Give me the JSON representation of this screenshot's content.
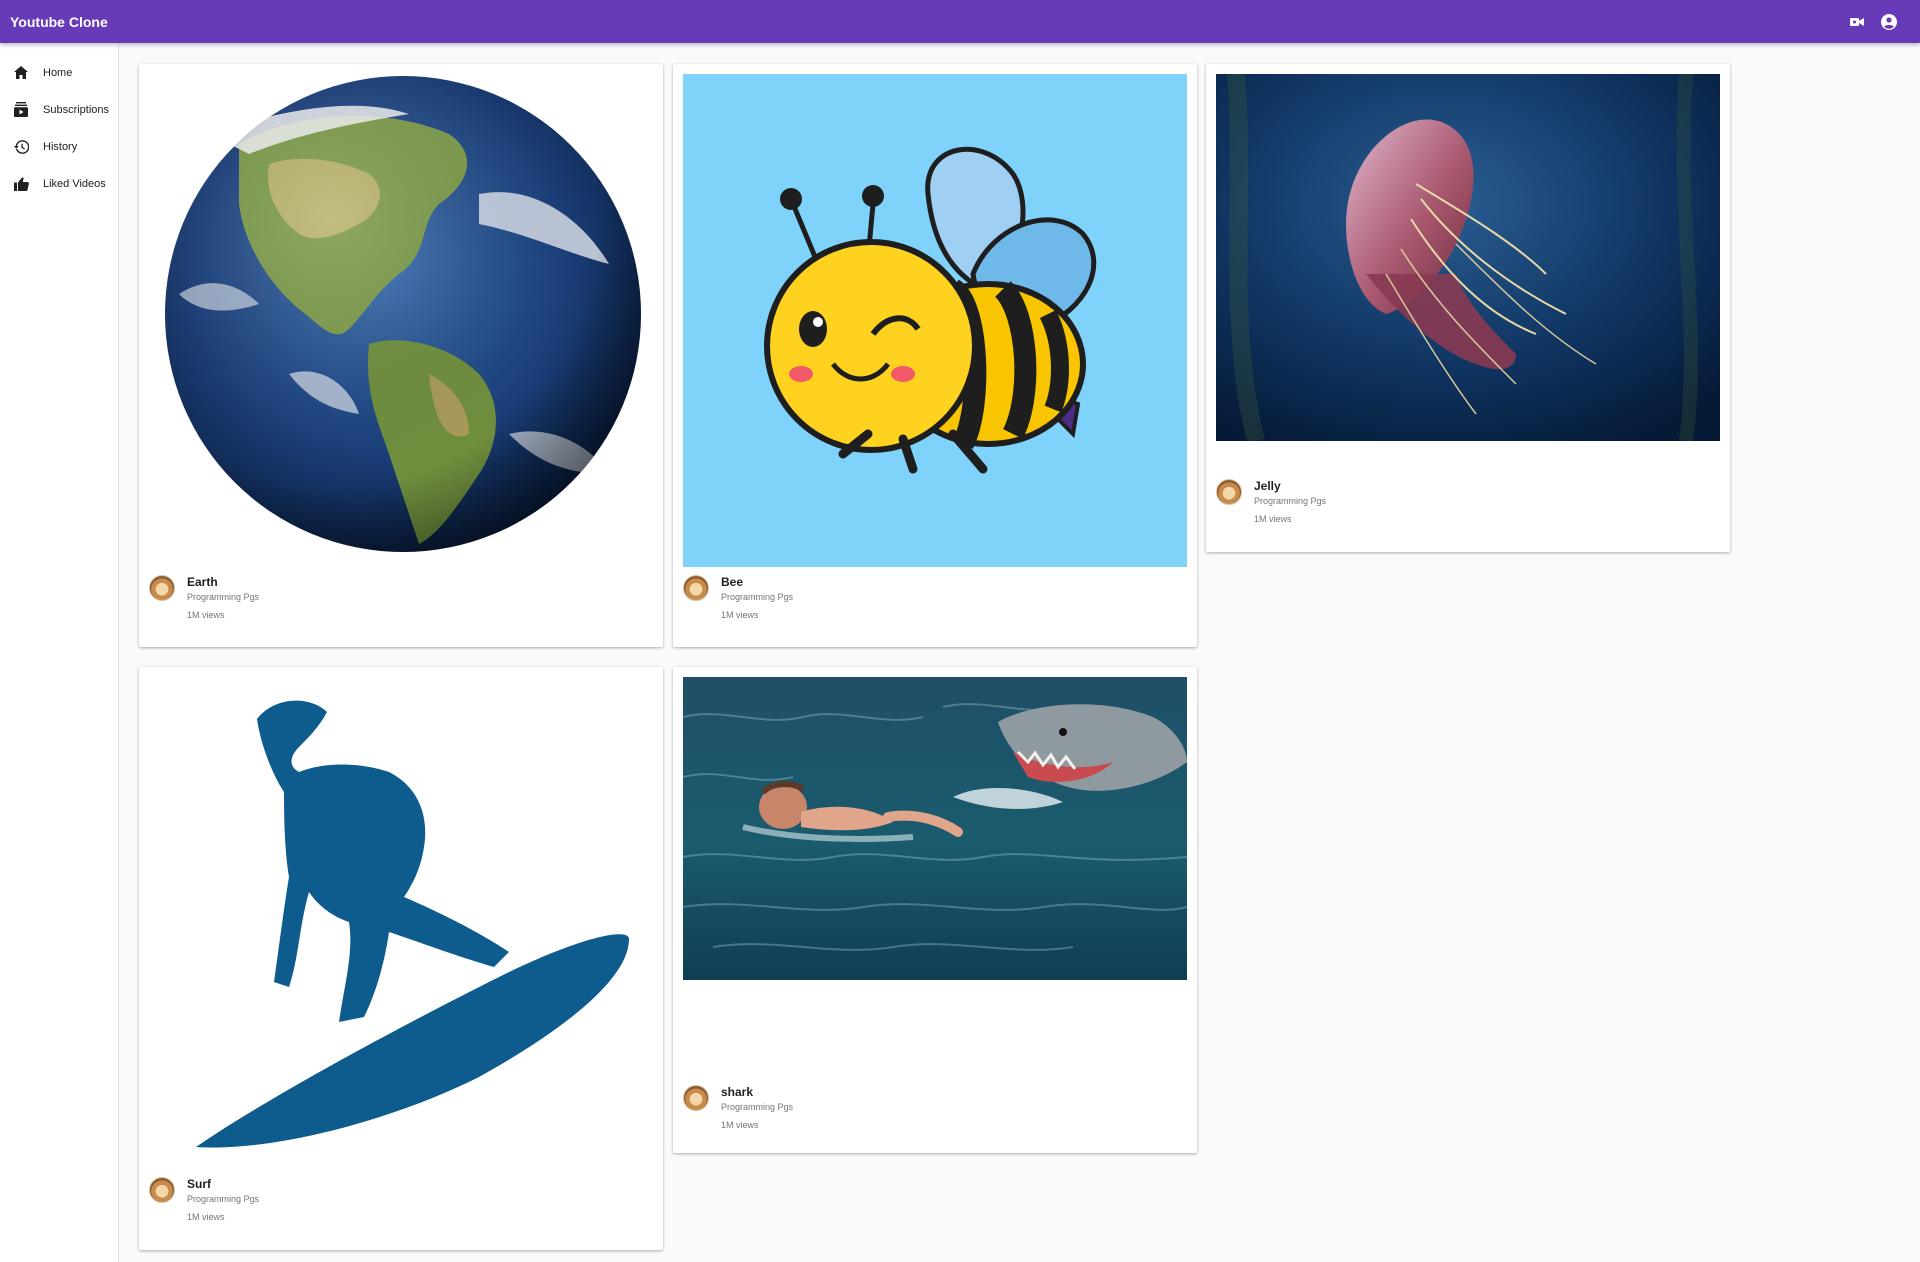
{
  "app": {
    "title": "Youtube Clone",
    "accent_color": "#673ab7",
    "actions": [
      {
        "icon": "video-camera-icon"
      },
      {
        "icon": "account-circle-icon"
      }
    ]
  },
  "sidebar": {
    "items": [
      {
        "label": "Home",
        "icon": "home-icon"
      },
      {
        "label": "Subscriptions",
        "icon": "subscriptions-icon"
      },
      {
        "label": "History",
        "icon": "history-icon"
      },
      {
        "label": "Liked Videos",
        "icon": "thumb-up-icon"
      }
    ]
  },
  "videos": [
    {
      "title": "Earth",
      "channel": "Programming Pgs",
      "views": "1M views",
      "thumbnail": "earth-globe"
    },
    {
      "title": "Bee",
      "channel": "Programming Pgs",
      "views": "1M views",
      "thumbnail": "cartoon-bee"
    },
    {
      "title": "Jelly",
      "channel": "Programming Pgs",
      "views": "1M views",
      "thumbnail": "jellyfish"
    },
    {
      "title": "Surf",
      "channel": "Programming Pgs",
      "views": "1M views",
      "thumbnail": "surfer-silhouette"
    },
    {
      "title": "shark",
      "channel": "Programming Pgs",
      "views": "1M views",
      "thumbnail": "shark-and-swimmer"
    }
  ]
}
